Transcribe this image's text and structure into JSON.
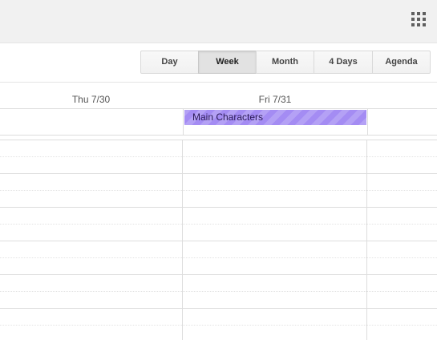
{
  "header": {
    "apps_icon": "apps-grid-icon"
  },
  "toolbar": {
    "views": [
      {
        "label": "Day",
        "active": false
      },
      {
        "label": "Week",
        "active": true
      },
      {
        "label": "Month",
        "active": false
      },
      {
        "label": "4 Days",
        "active": false
      },
      {
        "label": "Agenda",
        "active": false
      }
    ]
  },
  "calendar": {
    "days": [
      {
        "label": "Thu 7/30"
      },
      {
        "label": "Fri 7/31"
      }
    ],
    "all_day_events": [
      {
        "title": "Main Characters",
        "color": "#a48cf3"
      }
    ]
  },
  "colors": {
    "event_purple": "#a48cf3",
    "topbar_bg": "#f1f1f1",
    "grid_line": "#dddddd"
  }
}
